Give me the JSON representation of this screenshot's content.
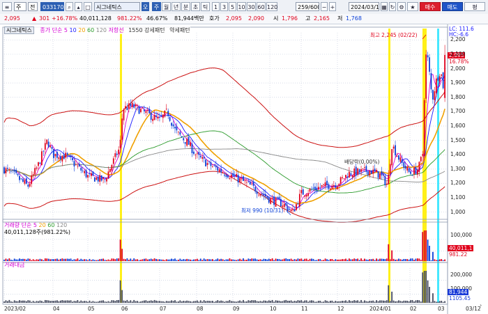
{
  "toolbar": {
    "code": "033170",
    "stock_name": "시그네틱스",
    "search_prefix": "주",
    "period_buttons": [
      "주",
      "월",
      "년",
      "분",
      "초",
      "틱"
    ],
    "minute_buttons": [
      "1",
      "3",
      "5",
      "10",
      "30",
      "60",
      "120"
    ],
    "count": "259/600",
    "date": "2024/03/12",
    "actions": [
      "매수",
      "매도",
      "평"
    ],
    "combo_label": "전",
    "group_label": "오"
  },
  "quote": {
    "price": "2,095",
    "change": "301",
    "change_pct": "+16.78%",
    "volume": "40,011,128",
    "vol_ratio": "981.22%",
    "turnover_ratio": "46.67%",
    "amount": "81,944백만",
    "ask_label": "호가",
    "ask1": "2,095",
    "ask2": "2,090",
    "open_label": "시",
    "open": "1,796",
    "high_label": "고",
    "high": "2,165",
    "low_label": "저",
    "low": "1,768"
  },
  "price_panel": {
    "legend_name": "시그네틱스",
    "legend_type": "종가 단순",
    "ma_periods": [
      "5",
      "10",
      "20",
      "60",
      "120"
    ],
    "ma_colors": [
      "#d400d4",
      "#1a1aff",
      "#f0a000",
      "#2a9a2a",
      "#888888"
    ],
    "extra_legend": [
      "저항선",
      "1550 강세패턴",
      "약세패턴"
    ],
    "high_annotation": "최고 2,245 (02/22)",
    "low_annotation": "최저 990 (10/31)",
    "dividend_annotation": "배당락(0.00%)",
    "right_tags": [
      "LC: 111.6",
      "HC:-6.6"
    ],
    "price_tag": "2,095",
    "pct_tag": "16.78%",
    "yaxis": [
      "2,200",
      "2,100",
      "2,000",
      "1,900",
      "1,800",
      "1,700",
      "1,600",
      "1,500",
      "1,400",
      "1,300",
      "1,200",
      "1,100",
      "1,000"
    ]
  },
  "volume_panel": {
    "legend": "거래량 단순",
    "ma_periods": [
      "5",
      "20",
      "60",
      "120"
    ],
    "stat": "40,011,128주(981.22%)",
    "yaxis": [
      "100,000",
      "50,000"
    ],
    "tag_value": "40,011,1",
    "tag_pct": "981.22"
  },
  "amount_panel": {
    "legend": "거래대금",
    "yaxis": [
      "200,000",
      "100,000"
    ],
    "tag_value": "81,944",
    "tag_pct": "1105.45"
  },
  "xaxis": [
    "2023/02",
    "04",
    "05",
    "06",
    "07",
    "08",
    "09",
    "10",
    "11",
    "12",
    "2024/01",
    "02",
    "03",
    "03/12"
  ],
  "colors": {
    "up": "#e0001b",
    "down": "#0a3fd8",
    "band": "#cc1111",
    "highlight_yellow": "#ffee00",
    "highlight_cyan": "#33e6ff"
  },
  "chart_data": {
    "type": "candlestick",
    "period": "daily",
    "x_range": [
      "2023/02",
      "2024/03/12"
    ],
    "ylim": [
      950,
      2250
    ],
    "key_points": [
      {
        "date": "2023/02",
        "close": 1300
      },
      {
        "date": "2023/04",
        "close": 1420
      },
      {
        "date": "2023/05",
        "close": 1250
      },
      {
        "date": "2023/06",
        "close": 1700
      },
      {
        "date": "2023/07",
        "close": 1630
      },
      {
        "date": "2023/08",
        "close": 1350
      },
      {
        "date": "2023/09",
        "close": 1230
      },
      {
        "date": "2023/10",
        "close": 1080
      },
      {
        "date": "2023/10/31",
        "low": 990
      },
      {
        "date": "2023/11",
        "close": 1160
      },
      {
        "date": "2023/12",
        "close": 1260
      },
      {
        "date": "2024/01",
        "close": 1300
      },
      {
        "date": "2024/02/22",
        "high": 2245
      },
      {
        "date": "2024/03/12",
        "open": 1796,
        "high": 2165,
        "low": 1768,
        "close": 2095
      }
    ]
  }
}
